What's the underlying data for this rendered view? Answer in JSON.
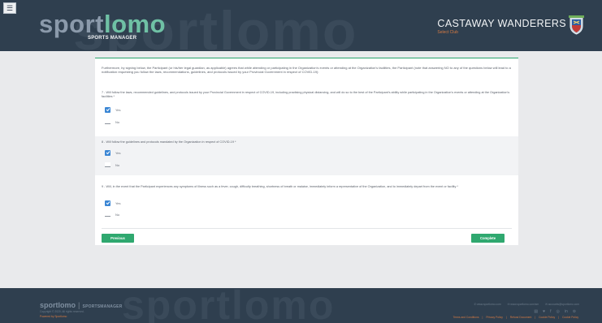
{
  "header": {
    "menu_icon": "☰",
    "bg_word": "sportlomo",
    "logo_part1": "sport",
    "logo_part2": "lomo",
    "logo_sub": "SPORTS MANAGER",
    "club_name": "CASTAWAY WANDERERS",
    "club_sub": "Select Club",
    "colors": {
      "bg": "#2f3f4f",
      "accent": "#6fc1a5",
      "orange": "#d77a42"
    }
  },
  "form": {
    "intro": "Furthermore, by signing below, the Participant (or his/her legal guardian, as applicable) agrees that while attending or participating in the Organization's events or attending at the Organization's facilities, the Participant (note that answering NO to any of the questions below will lead to a notification requesting you follow the laws, recommendations, guidelines, and protocols issued by your Provincial Government in respect of COVID-19):",
    "questions": [
      {
        "text": "7 - Will follow the laws, recommended guidelines, and protocols issued by your Provincial Government in respect of COVID-19, including practising physical distancing, and will do so to the best of the Participant's ability while participating in the Organization's events or attending at the Organization's facilities *",
        "yes": "Yes",
        "no": "No",
        "selected": "yes"
      },
      {
        "text": "8 - Will follow the guidelines and protocols mandated by the Organization in respect of COVID-19 *",
        "yes": "Yes",
        "no": "No",
        "selected": "yes"
      },
      {
        "text": "9 - Will, in the event that the Participant experiences any symptoms of illness such as a fever, cough, difficulty breathing, shortness of breath or malaise, immediately inform a representative of the Organization, and to immediately depart from the event or facility *",
        "yes": "Yes",
        "no": "No",
        "selected": "yes"
      }
    ],
    "previous_label": "Previous",
    "complete_label": "Complete"
  },
  "footer": {
    "bg_word": "sportlomo",
    "logo": "sportlomo",
    "logo_sub": "SPORTSMANAGER",
    "copyright": "Copyright © 2020. All rights reserved.",
    "secure": "Powered by Sportlomo",
    "contacts": [
      "✆ www.sportlomo.com",
      "✉ www.sportlomo.com/sm",
      "✉ accounts@sportlomo.com"
    ],
    "social": [
      "▤",
      "♥",
      "f",
      "◎",
      "in",
      "⊚"
    ],
    "links": [
      "Terms and Conditions",
      "|",
      "Privacy Policy",
      "|",
      "Refund Document",
      "|",
      "Cookie Policy",
      "|",
      "Cookie Policy"
    ]
  }
}
